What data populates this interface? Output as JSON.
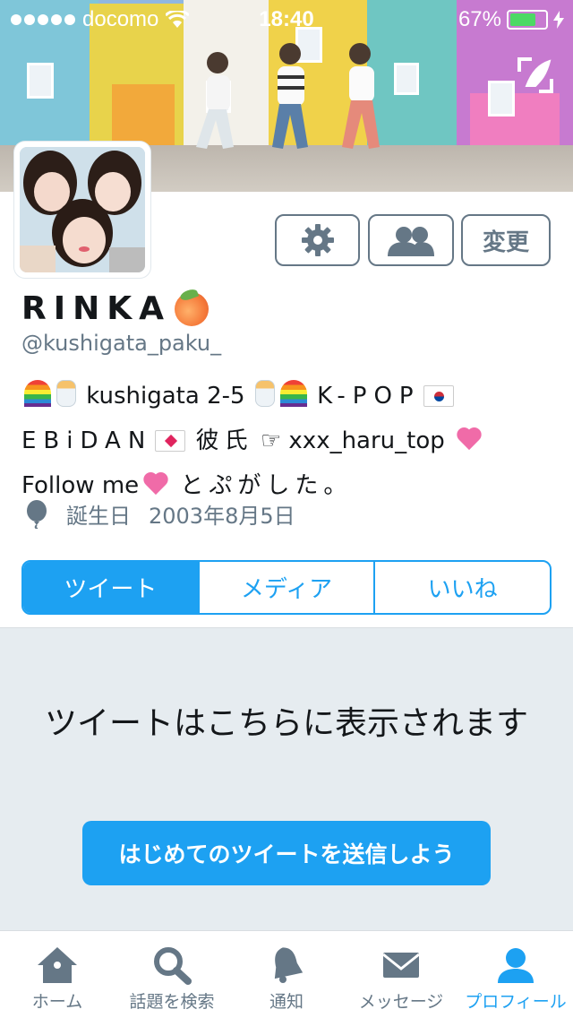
{
  "status_bar": {
    "carrier": "docomo",
    "time": "18:40",
    "battery": "67%",
    "battery_level": 0.67
  },
  "profile": {
    "name": "RINKA",
    "handle": "@kushigata_paku_",
    "bio": {
      "part1": "kushigata 2-5",
      "part2": "K-POP",
      "part3": "EBiDAN",
      "part4": "彼氏",
      "part5": "xxx_haru_top",
      "part6": "Follow me",
      "part7": "とぷがした。"
    },
    "birthday_label": "誕生日",
    "birthday_value": "2003年8月5日"
  },
  "actions": {
    "edit_label": "変更"
  },
  "tabs": [
    {
      "label": "ツイート"
    },
    {
      "label": "メディア"
    },
    {
      "label": "いいね"
    }
  ],
  "empty_state": {
    "message": "ツイートはこちらに表示されます",
    "cta_label": "はじめてのツイートを送信しよう"
  },
  "tabbar": [
    {
      "label": "ホーム",
      "icon": "home-icon"
    },
    {
      "label": "話題を検索",
      "icon": "search-icon"
    },
    {
      "label": "通知",
      "icon": "bell-icon"
    },
    {
      "label": "メッセージ",
      "icon": "envelope-icon"
    },
    {
      "label": "プロフィール",
      "icon": "person-icon"
    }
  ],
  "colors": {
    "accent": "#1da1f2",
    "secondary_text": "#657786",
    "empty_bg": "#e6ecf0"
  }
}
